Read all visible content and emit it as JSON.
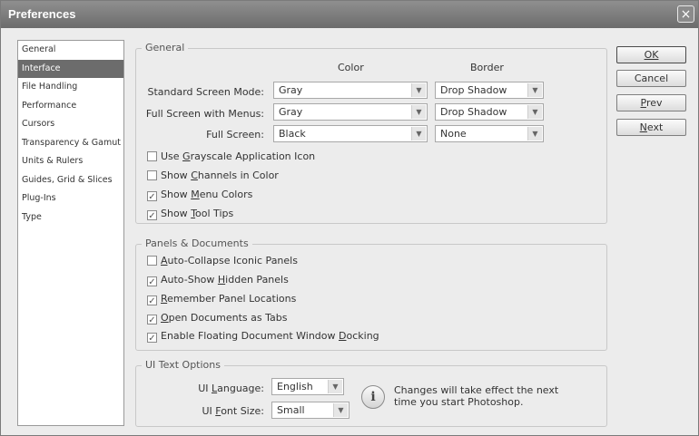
{
  "window": {
    "title": "Preferences",
    "close_glyph": "×"
  },
  "sidebar": {
    "items": [
      {
        "label": "General",
        "selected": false
      },
      {
        "label": "Interface",
        "selected": true
      },
      {
        "label": "File Handling",
        "selected": false
      },
      {
        "label": "Performance",
        "selected": false
      },
      {
        "label": "Cursors",
        "selected": false
      },
      {
        "label": "Transparency & Gamut",
        "selected": false
      },
      {
        "label": "Units & Rulers",
        "selected": false
      },
      {
        "label": "Guides, Grid & Slices",
        "selected": false
      },
      {
        "label": "Plug-Ins",
        "selected": false
      },
      {
        "label": "Type",
        "selected": false
      }
    ]
  },
  "general": {
    "legend": "General",
    "col_color": "Color",
    "col_border": "Border",
    "rows": [
      {
        "label": "Standard Screen Mode:",
        "color": "Gray",
        "border": "Drop Shadow"
      },
      {
        "label": "Full Screen with Menus:",
        "color": "Gray",
        "border": "Drop Shadow"
      },
      {
        "label": "Full Screen:",
        "color": "Black",
        "border": "None"
      }
    ],
    "checkboxes": [
      {
        "pre": "Use ",
        "key": "G",
        "post": "rayscale Application Icon",
        "checked": false
      },
      {
        "pre": "Show ",
        "key": "C",
        "post": "hannels in Color",
        "checked": false
      },
      {
        "pre": "Show ",
        "key": "M",
        "post": "enu Colors",
        "checked": true
      },
      {
        "pre": "Show ",
        "key": "T",
        "post": "ool Tips",
        "checked": true
      }
    ]
  },
  "panels": {
    "legend": "Panels & Documents",
    "checkboxes": [
      {
        "pre": "",
        "key": "A",
        "post": "uto-Collapse Iconic Panels",
        "checked": false
      },
      {
        "pre": "Auto-Show ",
        "key": "H",
        "post": "idden Panels",
        "checked": true
      },
      {
        "pre": "",
        "key": "R",
        "post": "emember Panel Locations",
        "checked": true
      },
      {
        "pre": "",
        "key": "O",
        "post": "pen Documents as Tabs",
        "checked": true
      },
      {
        "pre": "Enable Floating Document Window ",
        "key": "D",
        "post": "ocking",
        "checked": true
      }
    ]
  },
  "ui_text": {
    "legend": "UI Text Options",
    "language_pre": "UI ",
    "language_key": "L",
    "language_post": "anguage:",
    "language_value": "English",
    "fontsize_pre": "UI ",
    "fontsize_key": "F",
    "fontsize_post": "ont Size:",
    "fontsize_value": "Small",
    "info_glyph": "i",
    "info_line1": "Changes will take effect the next",
    "info_line2": "time you start Photoshop."
  },
  "buttons": {
    "ok": {
      "pre": "",
      "key": "OK",
      "post": ""
    },
    "cancel": {
      "pre": "Cancel",
      "key": "",
      "post": ""
    },
    "prev": {
      "pre": "",
      "key": "P",
      "post": "rev"
    },
    "next": {
      "pre": "",
      "key": "N",
      "post": "ext"
    }
  },
  "dropdown_glyph": "▼",
  "check_glyph": "✓"
}
